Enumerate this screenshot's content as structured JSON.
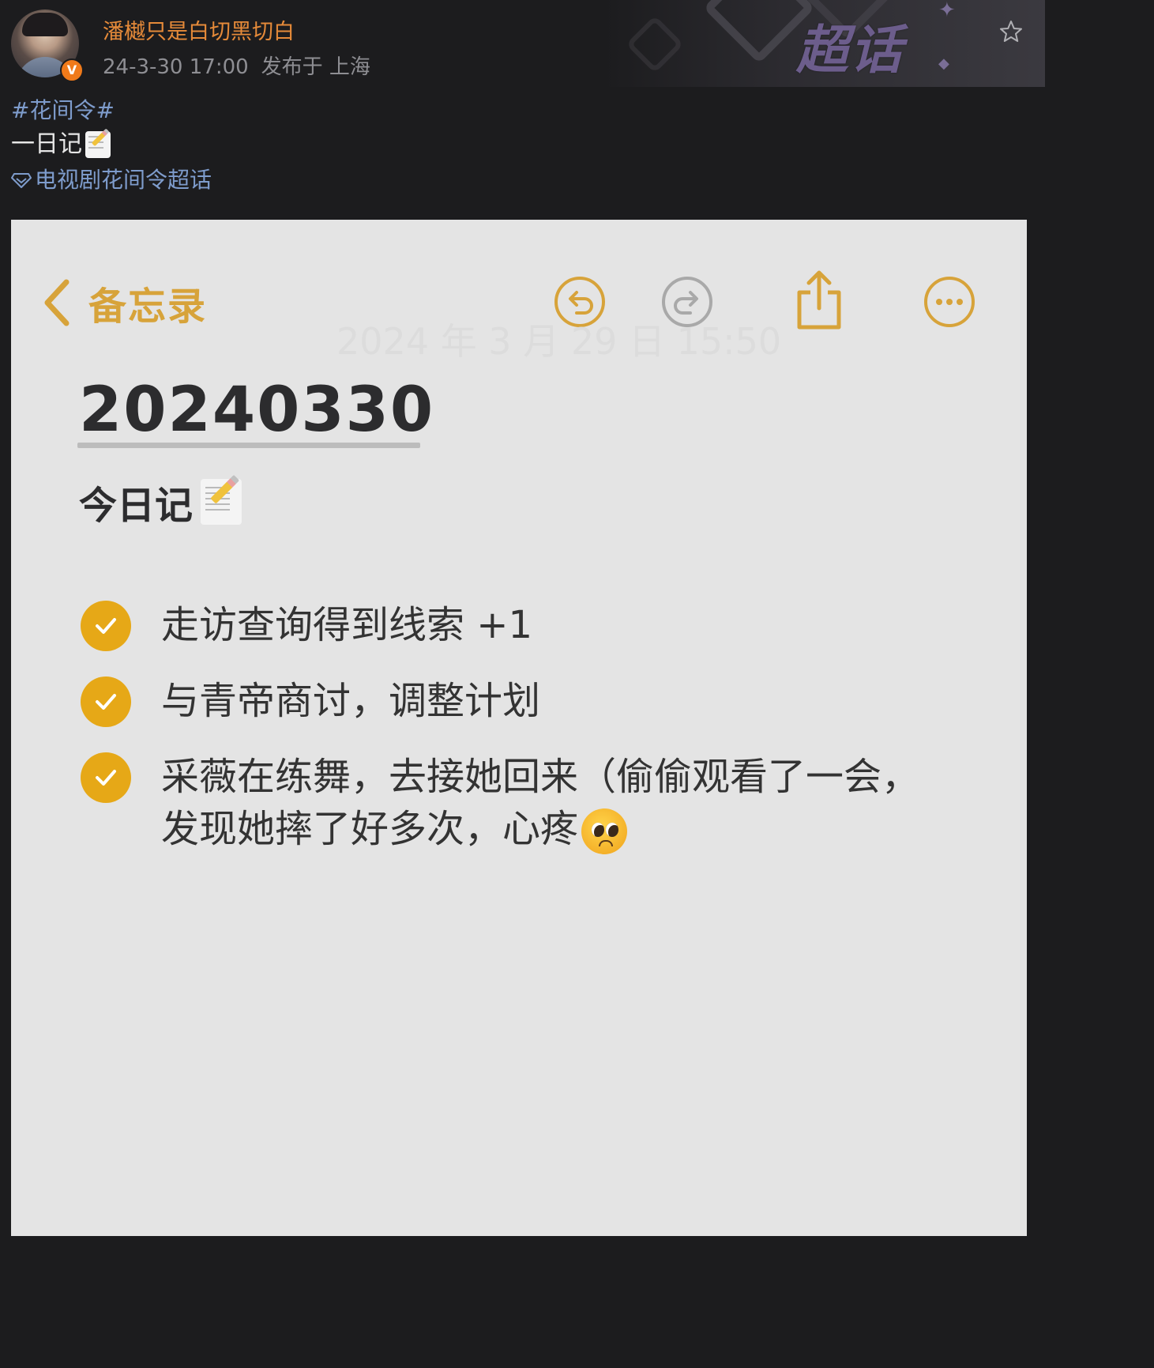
{
  "post": {
    "username": "潘樾只是白切黑切白",
    "time": "24-3-30 17:00",
    "location": "发布于 上海",
    "verified_mark": "V",
    "banner_text": "超话",
    "hashtag": "#花间令#",
    "body": "一日记",
    "supertopic": "电视剧花间令超话"
  },
  "note": {
    "back_label": "备忘录",
    "ghost_date": "2024 年 3 月 29 日 15:50",
    "title": "20240330",
    "subtitle": "今日记",
    "items": [
      {
        "text": "走访查询得到线索 +1"
      },
      {
        "text": "与青帝商讨，调整计划"
      },
      {
        "text": "采薇在练舞，去接她回来（偷偷观看了一会，发现她摔了好多次，心疼"
      }
    ]
  },
  "colors": {
    "accent": "#d7a33a",
    "check": "#e6a817",
    "username": "#e58a39",
    "link": "#7e9ccc",
    "note_bg": "#e4e4e4",
    "page_bg": "#1c1c1e"
  },
  "icons": [
    "avatar",
    "verified-badge",
    "star-icon",
    "supertopic-icon",
    "memo-emoji",
    "back-chevron-icon",
    "undo-icon",
    "redo-icon",
    "share-icon",
    "more-icon",
    "check-icon",
    "pleading-face-emoji"
  ]
}
